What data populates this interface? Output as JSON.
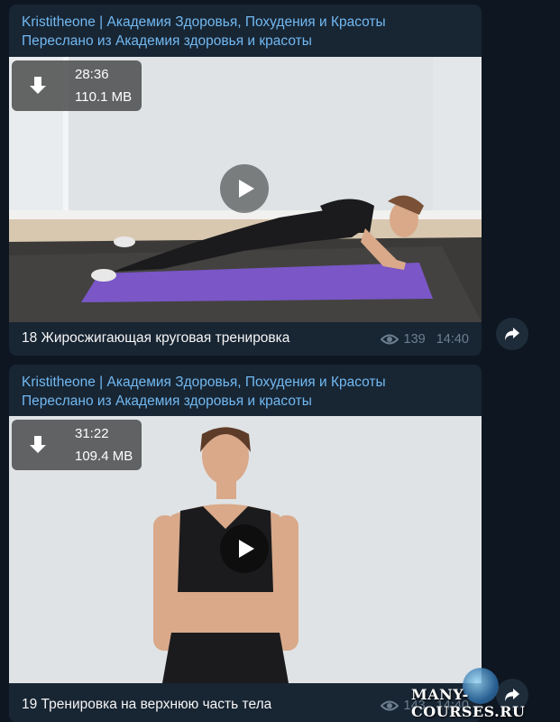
{
  "messages": [
    {
      "channel": "Kristitheone | Академия Здоровья, Похудения и Красоты",
      "forwarded": "Переслано из Академия здоровья и красоты",
      "video": {
        "duration": "28:36",
        "size": "110.1 MB"
      },
      "caption": "18 Жиросжигающая круговая тренировка",
      "views": "139",
      "time": "14:40"
    },
    {
      "channel": "Kristitheone | Академия Здоровья, Похудения и Красоты",
      "forwarded": "Переслано из Академия здоровья и красоты",
      "video": {
        "duration": "31:22",
        "size": "109.4 MB"
      },
      "caption": "19 Тренировка на верхнюю часть тела",
      "views": "143",
      "time": "14:40"
    }
  ],
  "watermark": "MANY-COURSES.RU",
  "colors": {
    "background": "#0e1621",
    "bubble": "#182533",
    "link": "#71b9f2",
    "meta": "#6d7f8f"
  }
}
